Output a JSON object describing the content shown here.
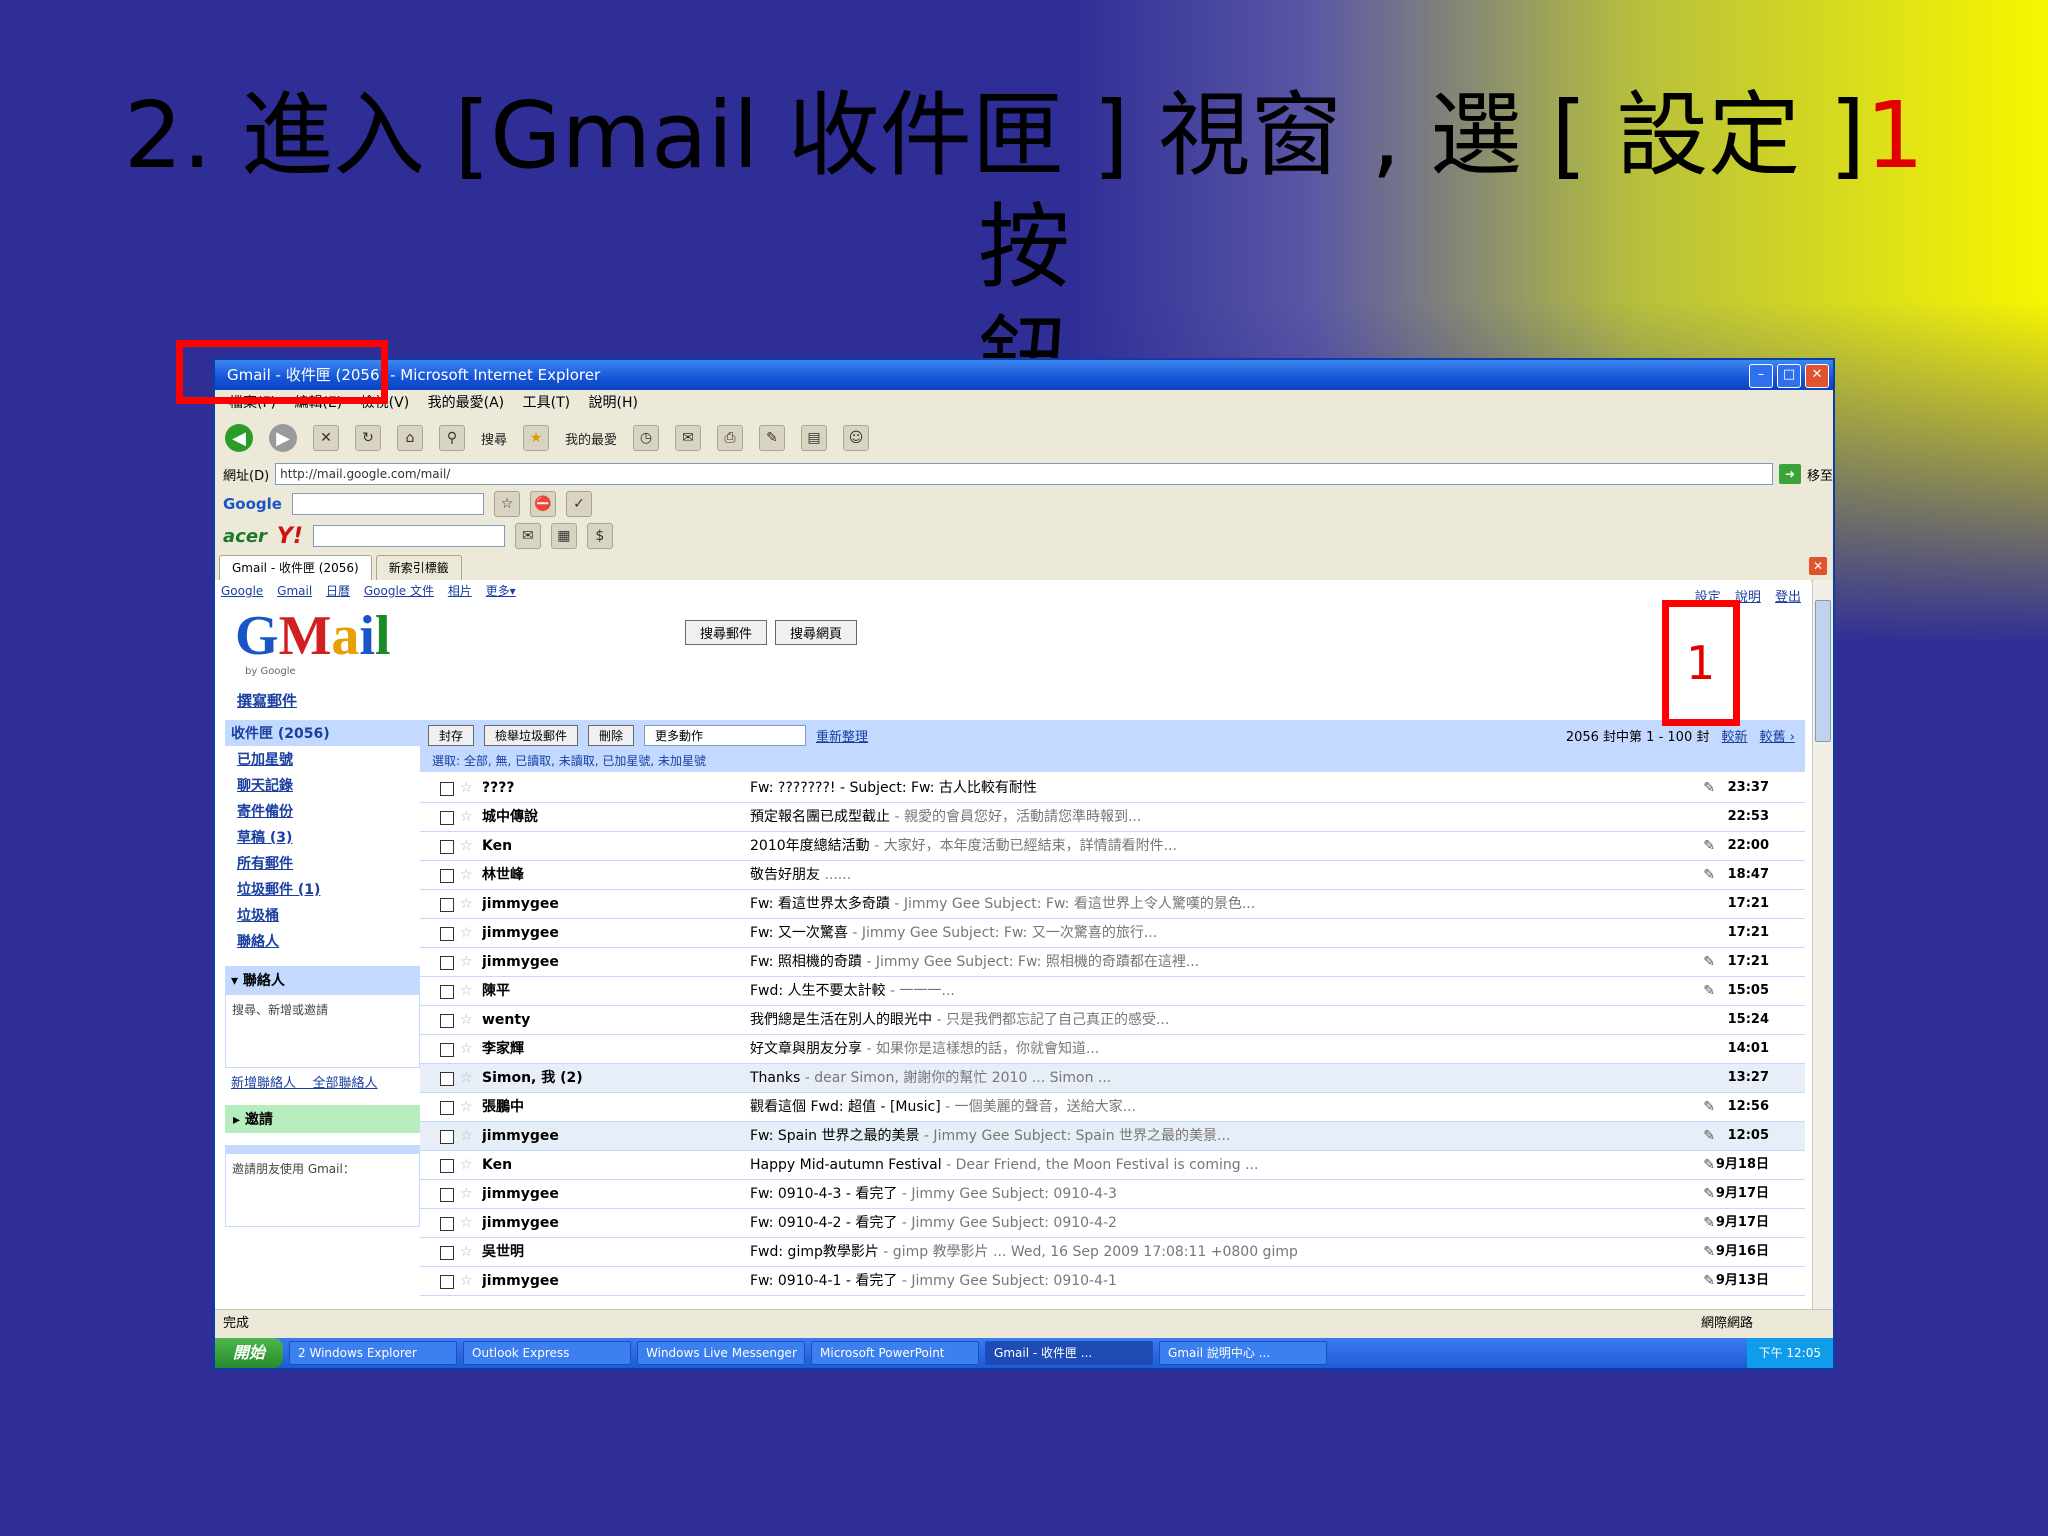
{
  "slide": {
    "title_line1_a": "2. 進入 [Gmail  收件匣 ] 視窗 , 選 [ 設定 ]",
    "title_line1_num": "1",
    "title_line1_b": " 按",
    "title_line2": "鈕",
    "callout_number": "1"
  },
  "window": {
    "title": "Gmail - 收件匣 (2056) - Microsoft Internet Explorer",
    "menu": [
      "檔案(F)",
      "編輯(E)",
      "檢視(V)",
      "我的最愛(A)",
      "工具(T)",
      "說明(H)"
    ],
    "toolbar": {
      "search": "搜尋",
      "favorites": "我的最愛"
    },
    "address_label": "網址(D)",
    "address_value": "http://mail.google.com/mail/",
    "go_label": "移至",
    "google_label": "Google",
    "acer_label": "acer",
    "yahoo_label": "Y!",
    "tabs": [
      "Gmail - 收件匣 (2056)",
      "新索引標籤"
    ]
  },
  "gmail": {
    "top_links": [
      "Google",
      "Gmail",
      "日曆",
      "Google 文件",
      "相片",
      "更多▾"
    ],
    "account_links": [
      "設定",
      "說明",
      "登出"
    ],
    "logo": [
      "G",
      "M",
      "a",
      "i",
      "l"
    ],
    "logo_sub": "by Google",
    "search_mail": "搜尋郵件",
    "search_web": "搜尋網頁",
    "compose": "撰寫郵件",
    "sidebar": {
      "inbox": "收件匣 (2056)",
      "items": [
        "已加星號",
        "聊天記錄",
        "寄件備份",
        "草稿 (3)",
        "所有郵件",
        "垃圾郵件 (1)",
        "垃圾桶",
        "聯絡人"
      ],
      "labels_box": "▾ 聯絡人",
      "labels_body": "搜尋、新增或邀請",
      "invite_box": "▸ 邀請",
      "invite_body": "邀請朋友使用 Gmail：",
      "quick_links": [
        "新增聯絡人",
        "全部聯絡人"
      ]
    },
    "actions": {
      "archive": "封存",
      "report_spam": "檢舉垃圾郵件",
      "delete": "刪除",
      "more": "更多動作",
      "refresh": "重新整理",
      "pager": "2056 封中第 1 - 100 封",
      "newer": "較新",
      "older": "較舊 ›",
      "select_row": "選取: 全部, 無, 已讀取, 未讀取, 已加星號, 未加星號"
    },
    "mails": [
      {
        "sender": "????",
        "subject": "Fw: ???????! - Subject: Fw: 古人比較有耐性",
        "snippet": "",
        "clip": "✎",
        "date": "23:37"
      },
      {
        "sender": "城中傳說",
        "subject": "預定報名團已成型截止",
        "snippet": " - 親愛的會員您好，活動請您準時報到...",
        "clip": "",
        "date": "22:53"
      },
      {
        "sender": "Ken",
        "subject": "2010年度總結活動",
        "snippet": " - 大家好，本年度活動已經結束，詳情請看附件...",
        "clip": "✎",
        "date": "22:00"
      },
      {
        "sender": "林世峰",
        "subject": "敬告好朋友",
        "snippet": " ......",
        "clip": "✎",
        "date": "18:47"
      },
      {
        "sender": "jimmygee",
        "subject": "Fw: 看這世界太多奇蹟",
        "snippet": " - Jimmy Gee Subject: Fw: 看這世界上令人驚嘆的景色...",
        "clip": "",
        "date": "17:21"
      },
      {
        "sender": "jimmygee",
        "subject": "Fw: 又一次驚喜",
        "snippet": " - Jimmy Gee Subject: Fw: 又一次驚喜的旅行...",
        "clip": "",
        "date": "17:21"
      },
      {
        "sender": "jimmygee",
        "subject": "Fw: 照相機的奇蹟",
        "snippet": " - Jimmy Gee Subject: Fw: 照相機的奇蹟都在這裡...",
        "clip": "✎",
        "date": "17:21"
      },
      {
        "sender": "陳平",
        "subject": "Fwd: 人生不要太計較",
        "snippet": " - 一一一...",
        "clip": "✎",
        "date": "15:05"
      },
      {
        "sender": "wenty",
        "subject": "我們總是生活在別人的眼光中",
        "snippet": " - 只是我們都忘記了自己真正的感受...",
        "clip": "",
        "date": "15:24"
      },
      {
        "sender": "李家輝",
        "subject": "好文章與朋友分享",
        "snippet": " - 如果你是這樣想的話，你就會知道...",
        "clip": "",
        "date": "14:01"
      },
      {
        "sender": "Simon, 我 (2)",
        "subject": "Thanks",
        "snippet": " - dear Simon, 謝謝你的幫忙 2010 ... Simon ...",
        "clip": "",
        "date": "13:27"
      },
      {
        "sender": "張鵬中",
        "subject": "觀看這個 Fwd: 超值 - [Music]",
        "snippet": " - 一個美麗的聲音，送給大家...",
        "clip": "✎",
        "date": "12:56"
      },
      {
        "sender": "jimmygee",
        "subject": "Fw: Spain 世界之最的美景",
        "snippet": " - Jimmy Gee Subject: Spain 世界之最的美景...",
        "clip": "✎",
        "date": "12:05"
      },
      {
        "sender": "Ken",
        "subject": "Happy Mid-autumn Festival",
        "snippet": " - Dear Friend, the Moon Festival is coming ...",
        "clip": "✎",
        "date": "9月18日"
      },
      {
        "sender": "jimmygee",
        "subject": "Fw: 0910-4-3 - 看完了",
        "snippet": " - Jimmy Gee Subject: 0910-4-3",
        "clip": "✎",
        "date": "9月17日"
      },
      {
        "sender": "jimmygee",
        "subject": "Fw: 0910-4-2 - 看完了",
        "snippet": " - Jimmy Gee Subject: 0910-4-2",
        "clip": "✎",
        "date": "9月17日"
      },
      {
        "sender": "吳世明",
        "subject": "Fwd: gimp教學影片",
        "snippet": " - gimp 教學影片 ... Wed, 16 Sep 2009 17:08:11 +0800 gimp",
        "clip": "✎",
        "date": "9月16日"
      },
      {
        "sender": "jimmygee",
        "subject": "Fw: 0910-4-1 - 看完了",
        "snippet": " - Jimmy Gee Subject: 0910-4-1",
        "clip": "✎",
        "date": "9月13日"
      }
    ]
  },
  "statusbar": {
    "text": "完成",
    "zone": "網際網路"
  },
  "taskbar": {
    "start": "開始",
    "tasks": [
      "2 Windows Explorer",
      "Outlook Express",
      "Windows Live Messenger",
      "Microsoft PowerPoint",
      "Gmail - 收件匣 ...",
      "Gmail 說明中心 ..."
    ],
    "clock": "下午 12:05"
  }
}
